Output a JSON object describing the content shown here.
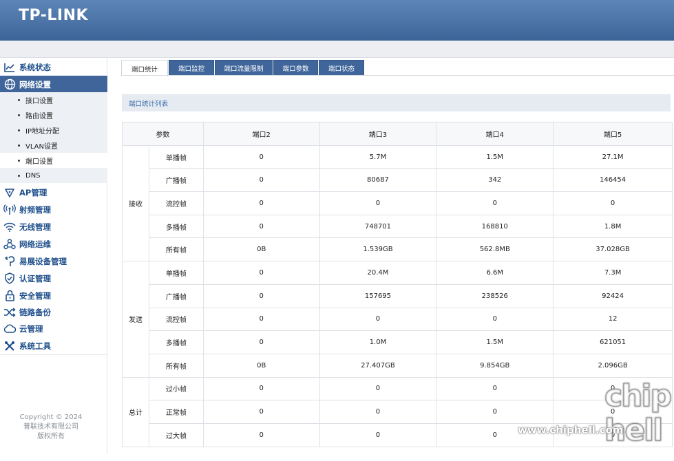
{
  "brand": {
    "logo": "TP-LINK"
  },
  "sidebar": {
    "items": [
      {
        "label": "系统状态",
        "icon": "chart-line-icon"
      },
      {
        "label": "网络设置",
        "icon": "globe-icon"
      },
      {
        "label": "AP管理",
        "icon": "ap-shield-icon"
      },
      {
        "label": "射频管理",
        "icon": "antenna-icon"
      },
      {
        "label": "无线管理",
        "icon": "wifi-icon"
      },
      {
        "label": "网络运维",
        "icon": "network-nodes-icon"
      },
      {
        "label": "易展设备管理",
        "icon": "plug-icon"
      },
      {
        "label": "认证管理",
        "icon": "shield-check-icon"
      },
      {
        "label": "安全管理",
        "icon": "lock-icon"
      },
      {
        "label": "链路备份",
        "icon": "shuffle-icon"
      },
      {
        "label": "云管理",
        "icon": "cloud-icon"
      },
      {
        "label": "系统工具",
        "icon": "tools-icon"
      }
    ],
    "subitems": [
      {
        "label": "接口设置"
      },
      {
        "label": "路由设置"
      },
      {
        "label": "IP地址分配"
      },
      {
        "label": "VLAN设置"
      },
      {
        "label": "端口设置"
      },
      {
        "label": "DNS"
      }
    ],
    "copyright": {
      "line1": "Copyright © 2024",
      "line2": "普联技术有限公司",
      "line3": "版权所有"
    }
  },
  "tabs": [
    {
      "label": "端口统计"
    },
    {
      "label": "端口监控"
    },
    {
      "label": "端口流量限制"
    },
    {
      "label": "端口参数"
    },
    {
      "label": "端口状态"
    }
  ],
  "section_title": "端口统计列表",
  "table": {
    "headers": [
      "参数",
      "端口2",
      "端口3",
      "端口4",
      "端口5"
    ],
    "groups": [
      {
        "name": "接收",
        "rows": [
          {
            "param": "单播帧",
            "values": [
              "0",
              "5.7M",
              "1.5M",
              "27.1M"
            ]
          },
          {
            "param": "广播帧",
            "values": [
              "0",
              "80687",
              "342",
              "146454"
            ]
          },
          {
            "param": "流控帧",
            "values": [
              "0",
              "0",
              "0",
              "0"
            ]
          },
          {
            "param": "多播帧",
            "values": [
              "0",
              "748701",
              "168810",
              "1.8M"
            ]
          },
          {
            "param": "所有帧",
            "values": [
              "0B",
              "1.539GB",
              "562.8MB",
              "37.028GB"
            ]
          }
        ]
      },
      {
        "name": "发送",
        "rows": [
          {
            "param": "单播帧",
            "values": [
              "0",
              "20.4M",
              "6.6M",
              "7.3M"
            ]
          },
          {
            "param": "广播帧",
            "values": [
              "0",
              "157695",
              "238526",
              "92424"
            ]
          },
          {
            "param": "流控帧",
            "values": [
              "0",
              "0",
              "0",
              "12"
            ]
          },
          {
            "param": "多播帧",
            "values": [
              "0",
              "1.0M",
              "1.5M",
              "621051"
            ]
          },
          {
            "param": "所有帧",
            "values": [
              "0B",
              "27.407GB",
              "9.854GB",
              "2.096GB"
            ]
          }
        ]
      },
      {
        "name": "总计",
        "rows": [
          {
            "param": "过小帧",
            "values": [
              "0",
              "0",
              "0",
              "0"
            ]
          },
          {
            "param": "正常帧",
            "values": [
              "0",
              "0",
              "0",
              "0"
            ]
          },
          {
            "param": "过大帧",
            "values": [
              "0",
              "0",
              "0",
              "0"
            ]
          }
        ]
      }
    ]
  },
  "watermark": {
    "site": "www.chiphell.com",
    "mark": "chip hell"
  },
  "colors": {
    "header": "#3d6498",
    "accent": "#1e4f8c",
    "active_nav": "#3f659a"
  }
}
